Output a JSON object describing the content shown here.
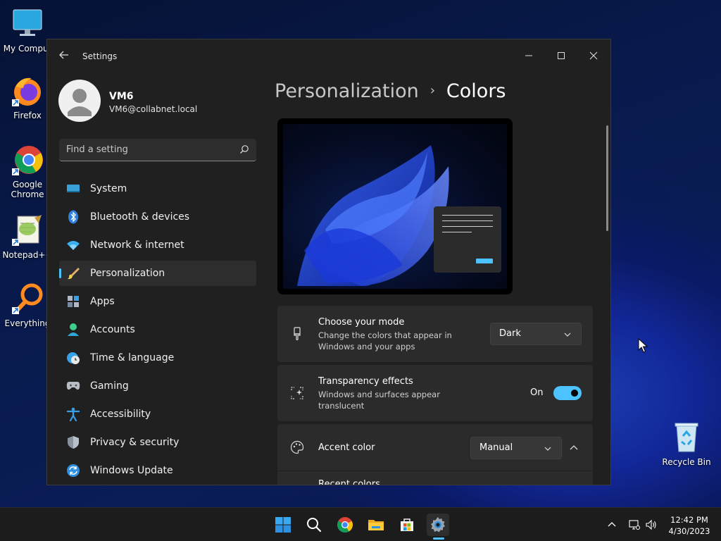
{
  "desktop": {
    "icons": [
      {
        "label": "My Comput"
      },
      {
        "label": "Firefox"
      },
      {
        "label": "Google Chrome"
      },
      {
        "label": "Notepad++"
      },
      {
        "label": "Everything"
      },
      {
        "label": "Recycle Bin"
      }
    ]
  },
  "window": {
    "title": "Settings",
    "controls": {
      "minimize": "minimize-icon",
      "maximize": "maximize-icon",
      "close": "close-icon"
    }
  },
  "profile": {
    "name": "VM6",
    "email": "VM6@collabnet.local"
  },
  "search": {
    "placeholder": "Find a setting"
  },
  "nav": {
    "items": [
      {
        "label": "System",
        "icon": "system-icon"
      },
      {
        "label": "Bluetooth & devices",
        "icon": "bluetooth-icon"
      },
      {
        "label": "Network & internet",
        "icon": "wifi-icon"
      },
      {
        "label": "Personalization",
        "icon": "brush-icon",
        "active": true
      },
      {
        "label": "Apps",
        "icon": "apps-icon"
      },
      {
        "label": "Accounts",
        "icon": "accounts-icon"
      },
      {
        "label": "Time & language",
        "icon": "clock-globe-icon"
      },
      {
        "label": "Gaming",
        "icon": "gamepad-icon"
      },
      {
        "label": "Accessibility",
        "icon": "accessibility-icon"
      },
      {
        "label": "Privacy & security",
        "icon": "shield-icon"
      },
      {
        "label": "Windows Update",
        "icon": "update-icon"
      }
    ]
  },
  "breadcrumb": {
    "parent": "Personalization",
    "separator": "›",
    "current": "Colors"
  },
  "settings": {
    "mode": {
      "title": "Choose your mode",
      "desc": "Change the colors that appear in Windows and your apps",
      "value": "Dark"
    },
    "transparency": {
      "title": "Transparency effects",
      "desc": "Windows and surfaces appear translucent",
      "state_label": "On",
      "enabled": true
    },
    "accent": {
      "title": "Accent color",
      "value": "Manual"
    },
    "recent": {
      "title": "Recent colors"
    }
  },
  "taskbar": {
    "apps": [
      "windows-start-icon",
      "search-icon",
      "chrome-icon",
      "file-explorer-icon",
      "store-icon",
      "settings-gear-icon"
    ]
  },
  "clock": {
    "time": "12:42 PM",
    "date": "4/30/2023"
  },
  "colors": {
    "accent": "#4cc2ff",
    "window_bg": "#202020",
    "card_bg": "#2b2b2b"
  }
}
